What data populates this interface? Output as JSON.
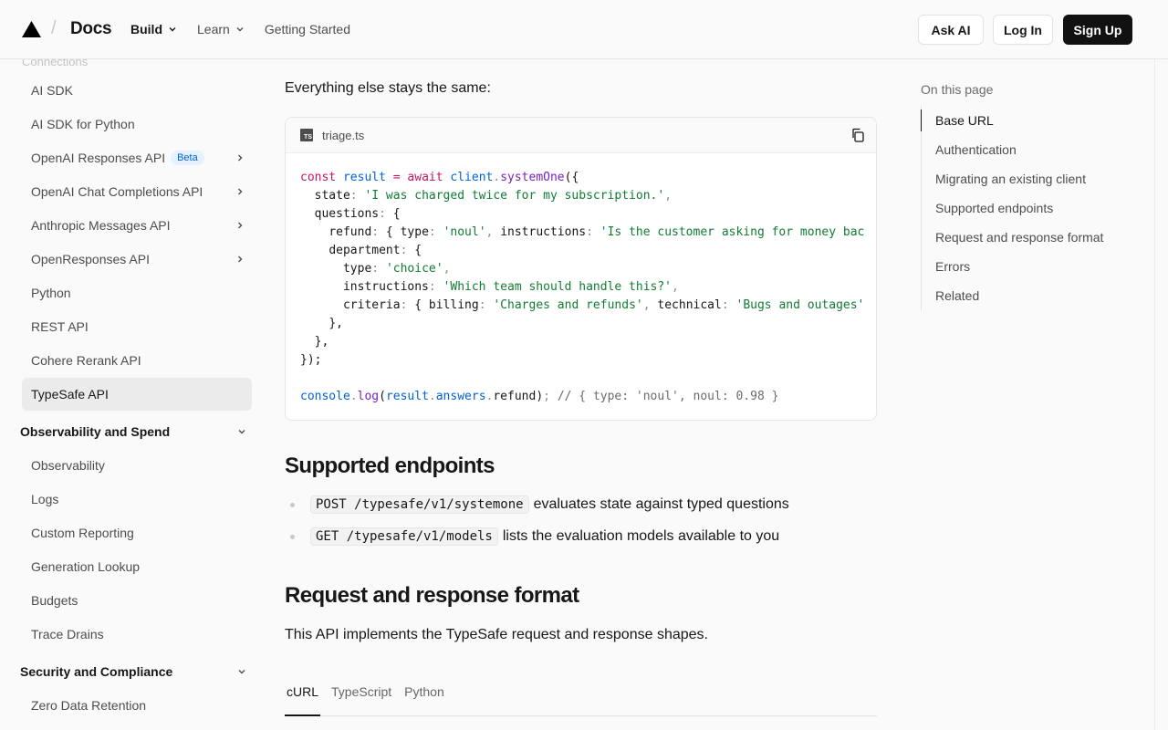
{
  "header": {
    "docs_label": "Docs",
    "nav": [
      {
        "label": "Build",
        "has_menu": true,
        "active": true
      },
      {
        "label": "Learn",
        "has_menu": true,
        "active": false
      },
      {
        "label": "Getting Started",
        "has_menu": false,
        "active": false
      }
    ],
    "ask_ai_label": "Ask AI",
    "login_label": "Log In",
    "signup_label": "Sign Up"
  },
  "sidebar": {
    "faded_heading": "Connections",
    "items": [
      {
        "label": "AI SDK"
      },
      {
        "label": "AI SDK for Python"
      },
      {
        "label": "OpenAI Responses API",
        "badge": "Beta",
        "expandable": true
      },
      {
        "label": "OpenAI Chat Completions API",
        "expandable": true
      },
      {
        "label": "Anthropic Messages API",
        "expandable": true
      },
      {
        "label": "OpenResponses API",
        "expandable": true
      },
      {
        "label": "Python"
      },
      {
        "label": "REST API"
      },
      {
        "label": "Cohere Rerank API"
      },
      {
        "label": "TypeSafe API",
        "selected": true
      }
    ],
    "section1": "Observability and Spend",
    "section1_items": [
      "Observability",
      "Logs",
      "Custom Reporting",
      "Generation Lookup",
      "Budgets",
      "Trace Drains"
    ],
    "section2": "Security and Compliance",
    "section2_items": [
      "Zero Data Retention"
    ]
  },
  "main": {
    "intro": "Everything else stays the same:",
    "code_filename": "triage.ts",
    "code_lang_icon": "TS",
    "code": {
      "l1": {
        "const": "const",
        "result": "result",
        "eq": " = ",
        "await": "await",
        "client": "client",
        "method": "systemOne",
        "open": "({"
      },
      "l2": {
        "key": "state",
        "val": "'I was charged twice for my subscription.'"
      },
      "l3": {
        "key": "questions"
      },
      "l4": {
        "key": "refund",
        "type_key": "type",
        "type_val": "'noul'",
        "instr_key": "instructions",
        "instr_val": "'Is the customer asking for money bac"
      },
      "l5": {
        "key": "department"
      },
      "l6": {
        "key": "type",
        "val": "'choice'"
      },
      "l7": {
        "key": "instructions",
        "val": "'Which team should handle this?'"
      },
      "l8": {
        "key": "criteria",
        "k1": "billing",
        "v1": "'Charges and refunds'",
        "k2": "technical",
        "v2": "'Bugs and outages'"
      },
      "l9": "},",
      "l10": "},",
      "l11": "});",
      "l12": {
        "console": "console",
        "log": "log",
        "result": "result",
        "answers": "answers",
        "refund": "refund",
        "comment": "// { type: 'noul', noul: 0.98 }"
      }
    },
    "h_endpoints": "Supported endpoints",
    "endpoints": [
      {
        "code": "POST /typesafe/v1/systemone",
        "text": "evaluates state against typed questions"
      },
      {
        "code": "GET /typesafe/v1/models",
        "text": "lists the evaluation models available to you"
      }
    ],
    "h_format": "Request and response format",
    "format_text": "This API implements the TypeSafe request and response shapes.",
    "tabs": [
      "cURL",
      "TypeScript",
      "Python"
    ],
    "active_tab": "cURL"
  },
  "toc": {
    "title": "On this page",
    "items": [
      "Base URL",
      "Authentication",
      "Migrating an existing client",
      "Supported endpoints",
      "Request and response format",
      "Errors",
      "Related"
    ],
    "active": "Base URL"
  },
  "icons": [
    "vercel-triangle-icon",
    "chevron-down-icon",
    "chevron-right-icon",
    "copy-icon",
    "typescript-file-icon"
  ]
}
